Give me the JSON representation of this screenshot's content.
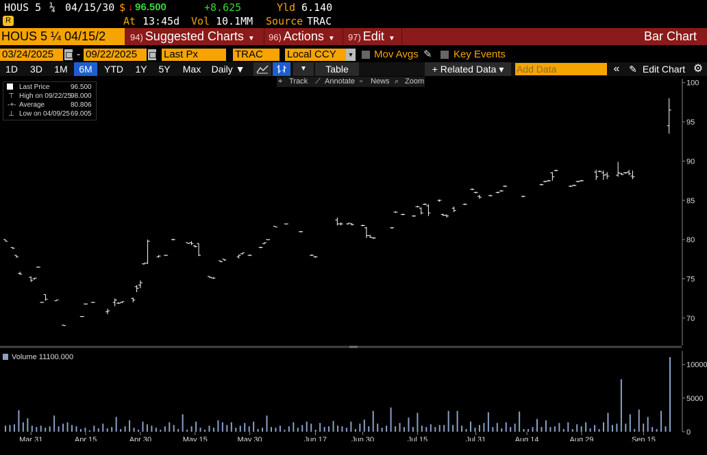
{
  "header": {
    "ticker": "HOUS 5",
    "coupon_frac": "¼",
    "maturity": "04/15/30",
    "currency_sym": "$",
    "arrow": "↓",
    "price": "96.500",
    "change": "+8.625",
    "yld_label": "Yld",
    "yld_value": "6.140",
    "at_label": "At",
    "time": "13:45d",
    "vol_label": "Vol",
    "vol_value": "10.1MM",
    "source_label": "Source",
    "source_value": "TRAC",
    "badge": "R"
  },
  "command_bar": {
    "security": "HOUS 5 ¼ 04/15/2",
    "items": [
      {
        "num": "94)",
        "label": "Suggested Charts"
      },
      {
        "num": "96)",
        "label": "Actions"
      },
      {
        "num": "97)",
        "label": "Edit"
      }
    ],
    "title": "Bar Chart"
  },
  "settings": {
    "start_date": "03/24/2025",
    "date_sep": "-",
    "end_date": "09/22/2025",
    "field": "Last Px",
    "source": "TRAC",
    "currency": "Local CCY",
    "mov_avgs": "Mov Avgs",
    "key_events": "Key Events"
  },
  "toolbar": {
    "periods": [
      "1D",
      "3D",
      "1M",
      "6M",
      "YTD",
      "1Y",
      "5Y",
      "Max"
    ],
    "active_period": "6M",
    "frequency": "Daily ▼",
    "table": "Table",
    "related": "+ Related Data ▾",
    "add_data_placeholder": "Add Data",
    "collapse": "«",
    "edit_chart": "Edit Chart"
  },
  "subtools": {
    "track": "Track",
    "annotate": "Annotate",
    "news": "News",
    "zoom": "Zoom"
  },
  "legend": {
    "last_label": "Last Price",
    "last_value": "96.500",
    "high_label": "High on 09/22/25",
    "high_value": "98.000",
    "avg_label": "Average",
    "avg_value": "80.806",
    "low_label": "Low on 04/09/25",
    "low_value": "69.005"
  },
  "volume_legend": {
    "label": "Volume",
    "value": "11100.000"
  },
  "colors": {
    "amber": "#f5a400",
    "price_green": "#35d935",
    "command_red": "#8b1a1a",
    "volume_bar": "#8aa0c8"
  },
  "chart_data": [
    {
      "type": "ohlc",
      "title": "",
      "ylim": [
        66.5,
        100.5
      ],
      "y_ticks": [
        70,
        75,
        80,
        85,
        90,
        95,
        100
      ],
      "y_axis": "right",
      "x_ticks": [
        "Mar 31",
        "Apr 15",
        "Apr 30",
        "May 15",
        "May 30",
        "Jun 17",
        "Jun 30",
        "Jul 15",
        "Jul 31",
        "Aug 14",
        "Aug 29",
        "Sep 15"
      ],
      "x_year": "2025",
      "grid": false,
      "bars": [
        {
          "date": "03/24",
          "o": 80,
          "h": 80,
          "l": 79.8,
          "c": 79.8
        },
        {
          "date": "03/26",
          "o": 79,
          "h": 79,
          "l": 78.8,
          "c": 78.9
        },
        {
          "date": "03/27",
          "o": 78,
          "h": 78,
          "l": 77.7,
          "c": 77.8
        },
        {
          "date": "03/28",
          "o": 75.7,
          "h": 75.9,
          "l": 75.5,
          "c": 75.6
        },
        {
          "date": "03/31",
          "o": 75.2,
          "h": 75.3,
          "l": 74.6,
          "c": 74.8
        },
        {
          "date": "04/01",
          "o": 75,
          "h": 75.1,
          "l": 74.9,
          "c": 75.1
        },
        {
          "date": "04/02",
          "o": 76.5,
          "h": 76.5,
          "l": 76.5,
          "c": 76.5
        },
        {
          "date": "04/03",
          "o": 72,
          "h": 72,
          "l": 72,
          "c": 72
        },
        {
          "date": "04/04",
          "o": 73,
          "h": 73,
          "l": 72.2,
          "c": 72.4
        },
        {
          "date": "04/07",
          "o": 72.2,
          "h": 72.3,
          "l": 72.2,
          "c": 72.3
        },
        {
          "date": "04/09",
          "o": 69.1,
          "h": 69.1,
          "l": 69.005,
          "c": 69.05
        },
        {
          "date": "04/14",
          "o": 70.2,
          "h": 70.2,
          "l": 70.2,
          "c": 70.2
        },
        {
          "date": "04/15",
          "o": 71.8,
          "h": 71.8,
          "l": 71.8,
          "c": 71.8
        },
        {
          "date": "04/17",
          "o": 72,
          "h": 72,
          "l": 72,
          "c": 72
        },
        {
          "date": "04/21",
          "o": 70.8,
          "h": 71.2,
          "l": 70.5,
          "c": 70.9
        },
        {
          "date": "04/23",
          "o": 72,
          "h": 72.5,
          "l": 71.5,
          "c": 72.3
        },
        {
          "date": "04/24",
          "o": 71.9,
          "h": 72,
          "l": 71.8,
          "c": 71.9
        },
        {
          "date": "04/25",
          "o": 72,
          "h": 72.1,
          "l": 71.9,
          "c": 72.1
        },
        {
          "date": "04/28",
          "o": 72.5,
          "h": 72.6,
          "l": 72,
          "c": 72.3
        },
        {
          "date": "04/29",
          "o": 74,
          "h": 74.2,
          "l": 73.3,
          "c": 73.8
        },
        {
          "date": "04/30",
          "o": 74.2,
          "h": 74.8,
          "l": 73.8,
          "c": 74.5
        },
        {
          "date": "05/01",
          "o": 76.9,
          "h": 77,
          "l": 76.8,
          "c": 77
        },
        {
          "date": "05/02",
          "o": 77,
          "h": 80,
          "l": 76.9,
          "c": 79.8
        },
        {
          "date": "05/05",
          "o": 77.8,
          "h": 78,
          "l": 77.7,
          "c": 77.9
        },
        {
          "date": "05/07",
          "o": 78,
          "h": 78,
          "l": 78,
          "c": 78
        },
        {
          "date": "05/09",
          "o": 80,
          "h": 80.1,
          "l": 79.9,
          "c": 80
        },
        {
          "date": "05/13",
          "o": 79.6,
          "h": 79.6,
          "l": 79.5,
          "c": 79.5
        },
        {
          "date": "05/14",
          "o": 79.6,
          "h": 79.8,
          "l": 79.3,
          "c": 79.5
        },
        {
          "date": "05/15",
          "o": 79.2,
          "h": 79.3,
          "l": 79,
          "c": 79.1
        },
        {
          "date": "05/16",
          "o": 79.5,
          "h": 79.5,
          "l": 77.9,
          "c": 78
        },
        {
          "date": "05/19",
          "o": 75.3,
          "h": 75.3,
          "l": 75.1,
          "c": 75.2
        },
        {
          "date": "05/20",
          "o": 75.1,
          "h": 75.2,
          "l": 75,
          "c": 75.1
        },
        {
          "date": "05/22",
          "o": 77.3,
          "h": 77.3,
          "l": 77.1,
          "c": 77.2
        },
        {
          "date": "05/23",
          "o": 77.5,
          "h": 77.5,
          "l": 77.3,
          "c": 77.4
        },
        {
          "date": "05/27",
          "o": 77.8,
          "h": 78.1,
          "l": 77.6,
          "c": 78
        },
        {
          "date": "05/28",
          "o": 78.2,
          "h": 78.3,
          "l": 78.1,
          "c": 78.3
        },
        {
          "date": "05/30",
          "o": 78,
          "h": 78.1,
          "l": 77.9,
          "c": 78
        },
        {
          "date": "06/02",
          "o": 79,
          "h": 79.1,
          "l": 78.9,
          "c": 79
        },
        {
          "date": "06/03",
          "o": 79.5,
          "h": 79.6,
          "l": 79.4,
          "c": 79.6
        },
        {
          "date": "06/04",
          "o": 80,
          "h": 80,
          "l": 80,
          "c": 80
        },
        {
          "date": "06/06",
          "o": 81.7,
          "h": 81.7,
          "l": 81.6,
          "c": 81.6
        },
        {
          "date": "06/09",
          "o": 82,
          "h": 82,
          "l": 82,
          "c": 82
        },
        {
          "date": "06/13",
          "o": 81,
          "h": 81.1,
          "l": 80.9,
          "c": 81
        },
        {
          "date": "06/16",
          "o": 78,
          "h": 78.1,
          "l": 77.9,
          "c": 78
        },
        {
          "date": "06/17",
          "o": 77.8,
          "h": 77.9,
          "l": 77.7,
          "c": 77.8
        },
        {
          "date": "06/23",
          "o": 82.5,
          "h": 82.8,
          "l": 81.8,
          "c": 82
        },
        {
          "date": "06/24",
          "o": 82,
          "h": 82.2,
          "l": 81.8,
          "c": 82
        },
        {
          "date": "06/26",
          "o": 82,
          "h": 82.1,
          "l": 81.9,
          "c": 82.1
        },
        {
          "date": "06/27",
          "o": 82,
          "h": 82.1,
          "l": 81.8,
          "c": 81.9
        },
        {
          "date": "06/30",
          "o": 81.8,
          "h": 81.9,
          "l": 81.7,
          "c": 81.8
        },
        {
          "date": "07/01",
          "o": 81.5,
          "h": 81.6,
          "l": 80.2,
          "c": 80.5
        },
        {
          "date": "07/02",
          "o": 80.5,
          "h": 80.6,
          "l": 80.2,
          "c": 80.3
        },
        {
          "date": "07/03",
          "o": 80.2,
          "h": 80.3,
          "l": 80.1,
          "c": 80.2
        },
        {
          "date": "07/08",
          "o": 81.5,
          "h": 81.6,
          "l": 81.4,
          "c": 81.5
        },
        {
          "date": "07/09",
          "o": 83.5,
          "h": 83.6,
          "l": 83.4,
          "c": 83.5
        },
        {
          "date": "07/11",
          "o": 83.2,
          "h": 83.3,
          "l": 83.1,
          "c": 83.2
        },
        {
          "date": "07/14",
          "o": 83,
          "h": 83.1,
          "l": 82.9,
          "c": 83
        },
        {
          "date": "07/15",
          "o": 84.2,
          "h": 84.3,
          "l": 84.1,
          "c": 84.2
        },
        {
          "date": "07/16",
          "o": 84,
          "h": 84.1,
          "l": 83.2,
          "c": 83.4
        },
        {
          "date": "07/17",
          "o": 84.5,
          "h": 84.6,
          "l": 84.4,
          "c": 84.5
        },
        {
          "date": "07/18",
          "o": 84.3,
          "h": 84.5,
          "l": 83,
          "c": 83.4
        },
        {
          "date": "07/21",
          "o": 85,
          "h": 85.1,
          "l": 84.8,
          "c": 85
        },
        {
          "date": "07/22",
          "o": 83.2,
          "h": 83.3,
          "l": 83,
          "c": 83.1
        },
        {
          "date": "07/23",
          "o": 83.1,
          "h": 83.2,
          "l": 82.8,
          "c": 83
        },
        {
          "date": "07/25",
          "o": 84,
          "h": 84.2,
          "l": 83.5,
          "c": 83.7
        },
        {
          "date": "07/28",
          "o": 84.5,
          "h": 84.6,
          "l": 84.4,
          "c": 84.5
        },
        {
          "date": "07/30",
          "o": 86.4,
          "h": 86.5,
          "l": 86.3,
          "c": 86.4
        },
        {
          "date": "07/31",
          "o": 86,
          "h": 86.1,
          "l": 85.9,
          "c": 86
        },
        {
          "date": "08/01",
          "o": 85.5,
          "h": 85.7,
          "l": 85.2,
          "c": 85.4
        },
        {
          "date": "08/04",
          "o": 85.6,
          "h": 85.7,
          "l": 85.5,
          "c": 85.6
        },
        {
          "date": "08/06",
          "o": 86,
          "h": 86.1,
          "l": 85.9,
          "c": 86
        },
        {
          "date": "08/07",
          "o": 86.2,
          "h": 86.3,
          "l": 86.1,
          "c": 86.2
        },
        {
          "date": "08/08",
          "o": 86.8,
          "h": 86.9,
          "l": 86.7,
          "c": 86.8
        },
        {
          "date": "08/13",
          "o": 85.5,
          "h": 85.6,
          "l": 85.4,
          "c": 85.5
        },
        {
          "date": "08/18",
          "o": 87,
          "h": 87.1,
          "l": 86.9,
          "c": 87
        },
        {
          "date": "08/19",
          "o": 87.4,
          "h": 87.5,
          "l": 87.3,
          "c": 87.4
        },
        {
          "date": "08/20",
          "o": 87.5,
          "h": 87.6,
          "l": 87.4,
          "c": 87.5
        },
        {
          "date": "08/21",
          "o": 88.5,
          "h": 88.6,
          "l": 87.5,
          "c": 88
        },
        {
          "date": "08/22",
          "o": 88.8,
          "h": 88.9,
          "l": 88.7,
          "c": 88.8
        },
        {
          "date": "08/26",
          "o": 86.8,
          "h": 86.9,
          "l": 86.7,
          "c": 86.8
        },
        {
          "date": "08/27",
          "o": 86.9,
          "h": 87,
          "l": 86.8,
          "c": 86.9
        },
        {
          "date": "08/28",
          "o": 87.4,
          "h": 87.5,
          "l": 87.3,
          "c": 87.4
        },
        {
          "date": "08/29",
          "o": 87.5,
          "h": 87.6,
          "l": 87.4,
          "c": 87.5
        },
        {
          "date": "09/02",
          "o": 88.6,
          "h": 88.9,
          "l": 87.6,
          "c": 88
        },
        {
          "date": "09/03",
          "o": 88.7,
          "h": 88.8,
          "l": 88.6,
          "c": 88.7
        },
        {
          "date": "09/04",
          "o": 88.5,
          "h": 88.8,
          "l": 87.6,
          "c": 88.2
        },
        {
          "date": "09/05",
          "o": 88.3,
          "h": 88.6,
          "l": 87.7,
          "c": 88.1
        },
        {
          "date": "09/08",
          "o": 88.2,
          "h": 89.9,
          "l": 88,
          "c": 88.5
        },
        {
          "date": "09/09",
          "o": 88.4,
          "h": 88.5,
          "l": 88.2,
          "c": 88.3
        },
        {
          "date": "09/10",
          "o": 88.5,
          "h": 88.6,
          "l": 88.4,
          "c": 88.5
        },
        {
          "date": "09/11",
          "o": 88.6,
          "h": 88.9,
          "l": 88.2,
          "c": 88.4
        },
        {
          "date": "09/12",
          "o": 88.1,
          "h": 88.8,
          "l": 87.7,
          "c": 88
        },
        {
          "date": "09/22",
          "o": 94.5,
          "h": 98,
          "l": 93.5,
          "c": 96.5
        }
      ]
    },
    {
      "type": "bar",
      "title": "",
      "series_name": "Volume",
      "ylim": [
        0,
        12000
      ],
      "y_ticks": [
        0,
        5000,
        10000
      ],
      "values": [
        900,
        1000,
        1100,
        3200,
        1400,
        2000,
        900,
        700,
        900,
        600,
        800,
        2400,
        800,
        1200,
        1400,
        1000,
        800,
        400,
        600,
        200,
        900,
        500,
        1200,
        500,
        700,
        2200,
        400,
        800,
        1700,
        600,
        300,
        1500,
        1100,
        900,
        600,
        300,
        800,
        1400,
        1000,
        400,
        2600,
        300,
        800,
        1500,
        600,
        300,
        900,
        600,
        1700,
        1400,
        1000,
        1400,
        600,
        900,
        1300,
        800,
        1500,
        400,
        600,
        2400,
        700,
        600,
        900,
        300,
        800,
        1400,
        600,
        1000,
        1500,
        1200,
        300,
        1300,
        700,
        800,
        1600,
        900,
        800,
        600,
        1500,
        400,
        1200,
        1800,
        800,
        3100,
        1200,
        600,
        900,
        3600,
        800,
        1300,
        700,
        2100,
        700,
        2800,
        900,
        700,
        1100,
        700,
        1000,
        1000,
        3100,
        1000,
        3100,
        900,
        400,
        1500,
        600,
        1000,
        1300,
        2900,
        700,
        1300,
        500,
        1400,
        700,
        1200,
        3000,
        400,
        400,
        700,
        1900,
        700,
        1700,
        700,
        800,
        1300,
        400,
        1400,
        400,
        1100,
        800,
        1400,
        500,
        1000,
        400,
        1400,
        2800,
        1000,
        1200,
        7800,
        1200,
        2600,
        400,
        3300,
        1200,
        2200,
        700,
        400,
        3100,
        800,
        11100
      ]
    }
  ]
}
